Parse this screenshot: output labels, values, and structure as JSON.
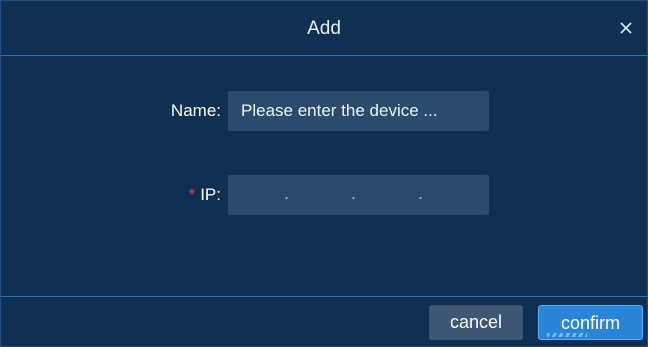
{
  "dialog": {
    "title": "Add",
    "close_icon": "close-icon"
  },
  "form": {
    "name": {
      "label": "Name:",
      "placeholder": "Please enter the device ...",
      "value": ""
    },
    "ip": {
      "required_mark": "*",
      "label": "IP:",
      "segments": [
        "",
        "",
        "",
        ""
      ],
      "separator": "."
    }
  },
  "footer": {
    "cancel_label": "cancel",
    "confirm_label": "confirm"
  },
  "colors": {
    "background": "#0f2f53",
    "divider": "#2a6fb2",
    "input_bg": "#2a4a6e",
    "required": "#e5393a",
    "primary": "#2a85d9",
    "secondary": "#3d5673"
  }
}
